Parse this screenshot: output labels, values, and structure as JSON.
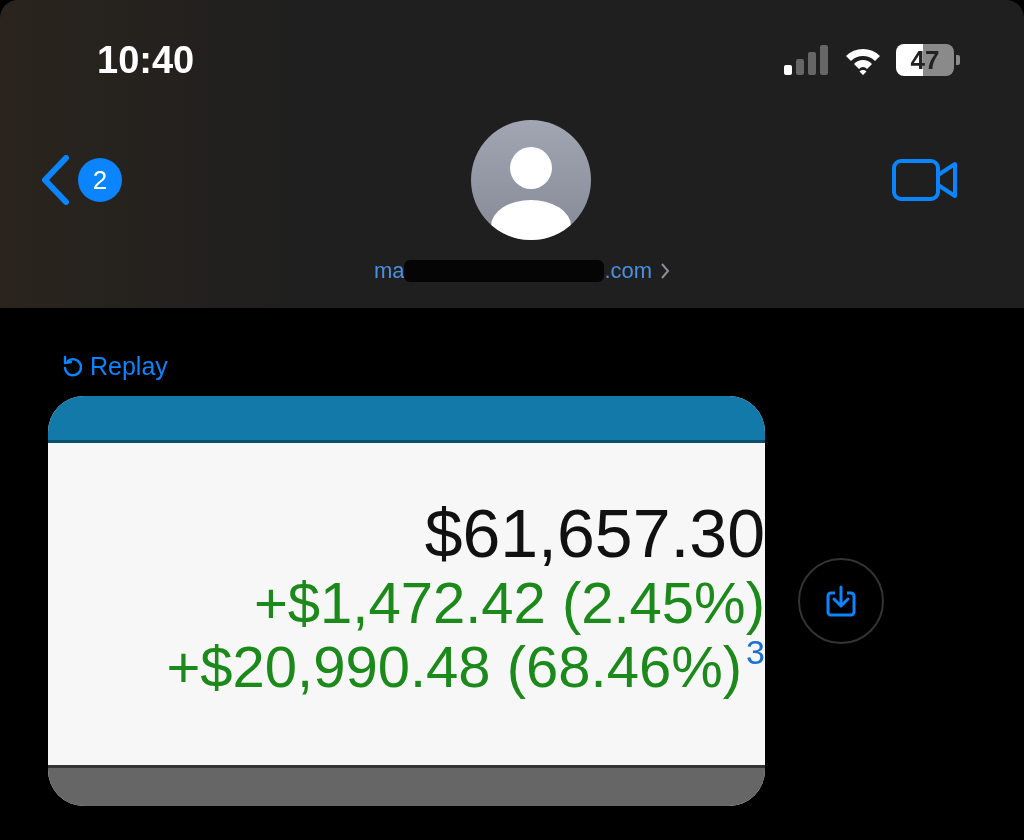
{
  "status_bar": {
    "time": "10:40",
    "battery": "47"
  },
  "nav": {
    "unread_count": "2",
    "contact_start": "ma",
    "contact_end": ".com"
  },
  "message": {
    "replay": "Replay",
    "total": "$61,657.30",
    "lines": [
      {
        "text": "+$1,472.42 (2.45%)"
      },
      {
        "text": "+$20,990.48 (68.46%)",
        "note": "3"
      }
    ]
  }
}
